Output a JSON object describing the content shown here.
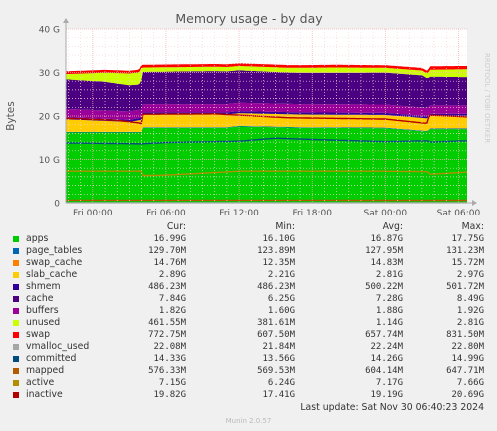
{
  "chart_data": {
    "type": "area",
    "title": "Memory usage - by day",
    "ylabel": "Bytes",
    "side_label": "RRDTOOL / TOBI OETIKER",
    "ylim": [
      0,
      40
    ],
    "y_unit": "G",
    "y_ticks": [
      "0",
      "10 G",
      "20 G",
      "30 G",
      "40 G"
    ],
    "x_ticks": [
      "Fri 00:00",
      "Fri 06:00",
      "Fri 12:00",
      "Fri 18:00",
      "Sat 00:00",
      "Sat 06:00"
    ],
    "x_tick_hours": [
      0,
      6,
      12,
      18,
      24,
      30
    ],
    "x_range_hours": [
      -2.2,
      30.7
    ],
    "stack_series": [
      {
        "name": "apps",
        "color": "#00cc00",
        "values": [
          [
            -2.2,
            16.2
          ],
          [
            4.0,
            16.2
          ],
          [
            4.1,
            17.3
          ],
          [
            11.0,
            17.3
          ],
          [
            12.0,
            17.6
          ],
          [
            17.0,
            17.3
          ],
          [
            24.0,
            17.2
          ],
          [
            27.5,
            16.4
          ],
          [
            27.6,
            17.0
          ],
          [
            30.7,
            17.0
          ]
        ]
      },
      {
        "name": "page_tables",
        "color": "#0066b3",
        "values": [
          [
            -2.2,
            0.128
          ],
          [
            30.7,
            0.13
          ]
        ]
      },
      {
        "name": "swap_cache",
        "color": "#ff8000",
        "values": [
          [
            -2.2,
            0.015
          ],
          [
            30.7,
            0.015
          ]
        ]
      },
      {
        "name": "slab_cache",
        "color": "#ffcc00",
        "values": [
          [
            -2.2,
            2.9
          ],
          [
            3.0,
            2.3
          ],
          [
            4.0,
            2.8
          ],
          [
            4.1,
            2.9
          ],
          [
            30.7,
            2.9
          ]
        ]
      },
      {
        "name": "shmem",
        "color": "#330099",
        "values": [
          [
            -2.2,
            0.49
          ],
          [
            30.7,
            0.49
          ]
        ]
      },
      {
        "name": "buffers",
        "color": "#990099",
        "values": [
          [
            -2.2,
            1.9
          ],
          [
            30.7,
            1.9
          ]
        ]
      },
      {
        "name": "cache",
        "color": "#4b0082",
        "values": [
          [
            -2.2,
            6.8
          ],
          [
            1.0,
            6.6
          ],
          [
            3.8,
            5.8
          ],
          [
            4.1,
            7.4
          ],
          [
            10.0,
            7.6
          ],
          [
            16.0,
            7.2
          ],
          [
            22.0,
            7.3
          ],
          [
            27.0,
            7.4
          ],
          [
            27.6,
            6.6
          ],
          [
            30.7,
            6.5
          ]
        ]
      },
      {
        "name": "unused",
        "color": "#ccff00",
        "values": [
          [
            -2.2,
            1.2
          ],
          [
            0.0,
            1.8
          ],
          [
            3.0,
            2.7
          ],
          [
            4.0,
            2.8
          ],
          [
            4.1,
            1.0
          ],
          [
            12.0,
            1.0
          ],
          [
            20.0,
            1.2
          ],
          [
            24.0,
            1.1
          ],
          [
            27.5,
            1.1
          ],
          [
            27.6,
            1.6
          ],
          [
            30.7,
            1.8
          ]
        ]
      },
      {
        "name": "swap",
        "color": "#ff0000",
        "values": [
          [
            -2.2,
            0.65
          ],
          [
            27.5,
            0.6
          ],
          [
            27.6,
            0.8
          ],
          [
            30.7,
            0.77
          ]
        ]
      }
    ],
    "line_series": [
      {
        "name": "vmalloc_used",
        "color": "#a6a6a6",
        "values": [
          [
            -2.2,
            0.022
          ],
          [
            30.7,
            0.022
          ]
        ]
      },
      {
        "name": "committed",
        "color": "#004c7f",
        "values": [
          [
            -2.2,
            13.8
          ],
          [
            4.0,
            13.6
          ],
          [
            6.0,
            13.9
          ],
          [
            12.0,
            14.2
          ],
          [
            15.0,
            14.9
          ],
          [
            18.0,
            14.6
          ],
          [
            24.0,
            14.1
          ],
          [
            27.5,
            14.3
          ],
          [
            27.6,
            14.0
          ],
          [
            30.7,
            14.3
          ]
        ]
      },
      {
        "name": "mapped",
        "color": "#b35a00",
        "values": [
          [
            -2.2,
            0.6
          ],
          [
            30.7,
            0.58
          ]
        ]
      },
      {
        "name": "active",
        "color": "#b38f00",
        "values": [
          [
            -2.2,
            7.3
          ],
          [
            4.0,
            7.3
          ],
          [
            4.1,
            6.3
          ],
          [
            6.0,
            6.4
          ],
          [
            12.0,
            7.3
          ],
          [
            24.0,
            7.3
          ],
          [
            27.5,
            7.2
          ],
          [
            27.6,
            6.6
          ],
          [
            30.7,
            7.1
          ]
        ]
      },
      {
        "name": "inactive",
        "color": "#b30000",
        "values": [
          [
            -2.2,
            19.5
          ],
          [
            2.0,
            19.0
          ],
          [
            3.8,
            18.4
          ],
          [
            4.0,
            18.2
          ],
          [
            4.1,
            20.4
          ],
          [
            10.0,
            20.5
          ],
          [
            16.0,
            19.6
          ],
          [
            24.0,
            19.3
          ],
          [
            27.4,
            18.3
          ],
          [
            27.6,
            20.2
          ],
          [
            30.7,
            19.8
          ]
        ]
      }
    ]
  },
  "legend": {
    "headers": {
      "cur": "Cur:",
      "min": "Min:",
      "avg": "Avg:",
      "max": "Max:"
    },
    "rows": [
      {
        "name": "apps",
        "color": "#00cc00",
        "cur": "16.99G",
        "min": "16.10G",
        "avg": "16.87G",
        "max": "17.75G"
      },
      {
        "name": "page_tables",
        "color": "#0066b3",
        "cur": "129.70M",
        "min": "123.89M",
        "avg": "127.95M",
        "max": "131.23M"
      },
      {
        "name": "swap_cache",
        "color": "#ff8000",
        "cur": "14.76M",
        "min": "12.35M",
        "avg": "14.83M",
        "max": "15.72M"
      },
      {
        "name": "slab_cache",
        "color": "#ffcc00",
        "cur": "2.89G",
        "min": "2.21G",
        "avg": "2.81G",
        "max": "2.97G"
      },
      {
        "name": "shmem",
        "color": "#330099",
        "cur": "486.23M",
        "min": "486.23M",
        "avg": "500.22M",
        "max": "501.72M"
      },
      {
        "name": "cache",
        "color": "#4b0082",
        "cur": "7.84G",
        "min": "6.25G",
        "avg": "7.28G",
        "max": "8.49G"
      },
      {
        "name": "buffers",
        "color": "#990099",
        "cur": "1.82G",
        "min": "1.60G",
        "avg": "1.88G",
        "max": "1.92G"
      },
      {
        "name": "unused",
        "color": "#ccff00",
        "cur": "461.55M",
        "min": "381.61M",
        "avg": "1.14G",
        "max": "2.81G"
      },
      {
        "name": "swap",
        "color": "#ff0000",
        "cur": "772.75M",
        "min": "607.50M",
        "avg": "657.74M",
        "max": "831.50M"
      },
      {
        "name": "vmalloc_used",
        "color": "#a6a6a6",
        "cur": "22.08M",
        "min": "21.84M",
        "avg": "22.24M",
        "max": "22.80M"
      },
      {
        "name": "committed",
        "color": "#004c7f",
        "cur": "14.33G",
        "min": "13.56G",
        "avg": "14.26G",
        "max": "14.99G"
      },
      {
        "name": "mapped",
        "color": "#b35a00",
        "cur": "576.33M",
        "min": "569.53M",
        "avg": "604.14M",
        "max": "647.71M"
      },
      {
        "name": "active",
        "color": "#b38f00",
        "cur": "7.15G",
        "min": "6.24G",
        "avg": "7.17G",
        "max": "7.66G"
      },
      {
        "name": "inactive",
        "color": "#b30000",
        "cur": "19.82G",
        "min": "17.41G",
        "avg": "19.19G",
        "max": "20.69G"
      }
    ]
  },
  "footer": {
    "last_update": "Last update: Sat Nov 30 06:40:23 2024",
    "munin": "Munin 2.0.57"
  }
}
